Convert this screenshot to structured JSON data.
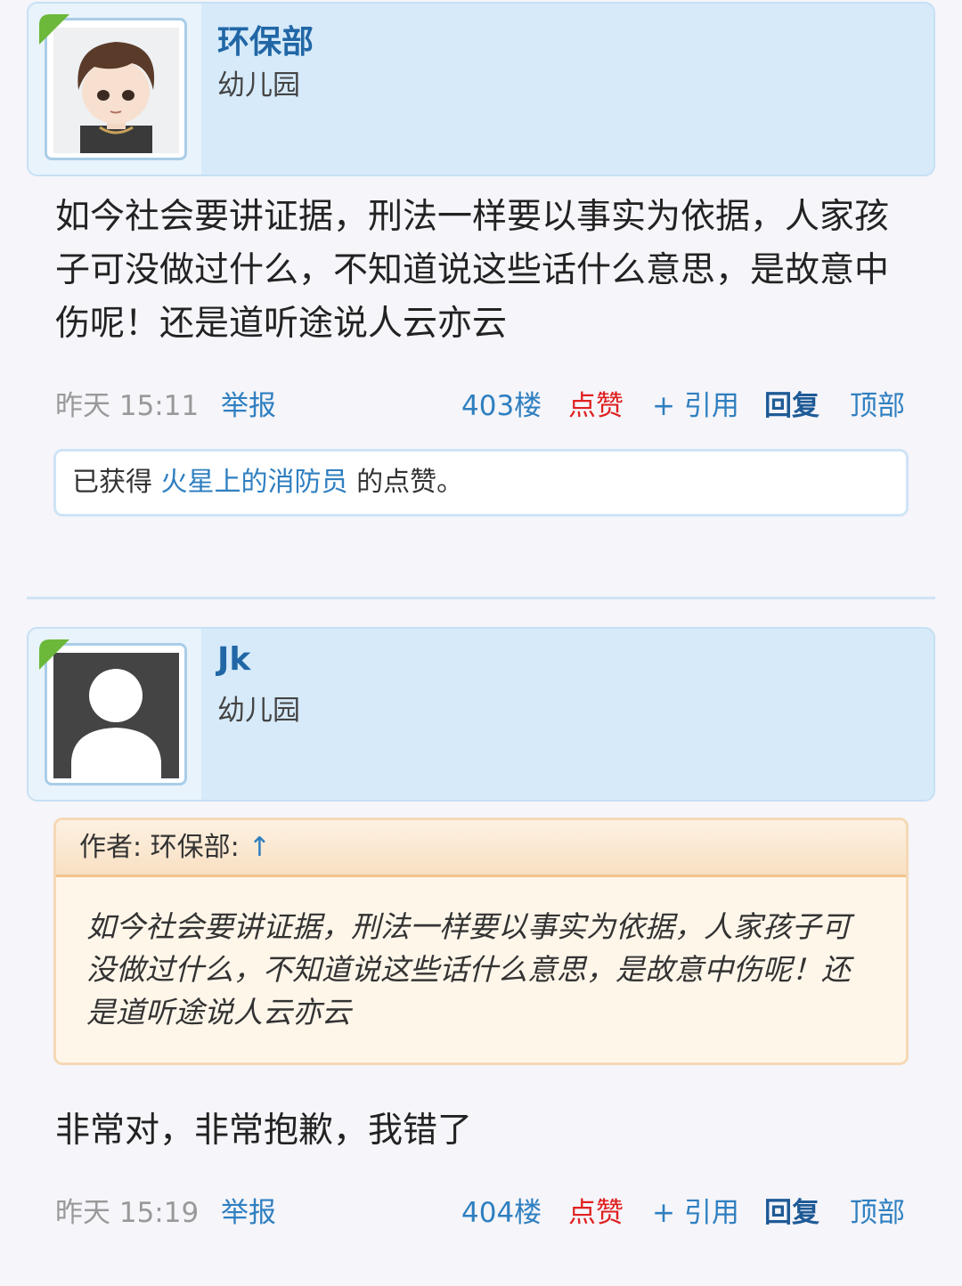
{
  "posts": [
    {
      "username": "环保部",
      "level": "幼儿园",
      "body": "如今社会要讲证据，刑法一样要以事实为依据，人家孩子可没做过什么，不知道说这些话什么意思，是故意中伤呢！还是道听途说人云亦云",
      "time": "昨天 15:11",
      "report": "举报",
      "floor": "403楼",
      "like": "点赞",
      "quote": "+ 引用",
      "reply": "回复",
      "top": "顶部",
      "likes_prefix": "已获得",
      "liker": "火星上的消防员",
      "likes_suffix": "的点赞。",
      "avatar": "cartoon-boy-avatar"
    },
    {
      "username": "Jk",
      "level": "幼儿园",
      "quote_header": "作者: 环保部:",
      "quote_arrow": "↑",
      "quote_text": "如今社会要讲证据，刑法一样要以事实为依据，人家孩子可没做过什么，不知道说这些话什么意思，是故意中伤呢！还是道听途说人云亦云",
      "body": "非常对，非常抱歉，我错了",
      "time": "昨天 15:19",
      "report": "举报",
      "floor": "404楼",
      "like": "点赞",
      "quote": "+ 引用",
      "reply": "回复",
      "top": "顶部",
      "avatar": "default-user-avatar"
    }
  ],
  "colors": {
    "link": "#2f7fc0",
    "like": "#e02020",
    "header_bg": "#d6eafa",
    "quote_bg": "#fff6ea"
  }
}
